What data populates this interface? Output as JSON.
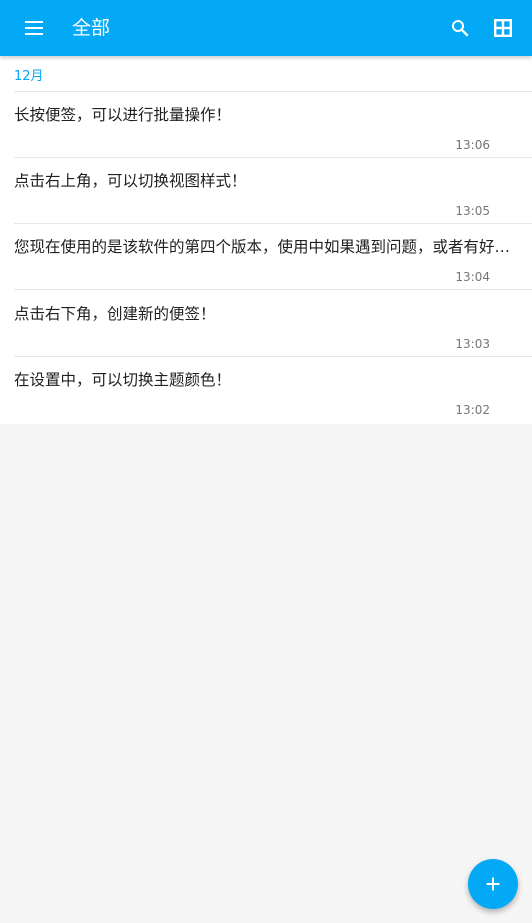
{
  "app_bar": {
    "title": "全部",
    "background_color": "#03a9f4",
    "menu_icon": "menu-icon",
    "search_icon": "search-icon",
    "view_toggle_icon": "grid-view-icon"
  },
  "list": {
    "month_header": "12月",
    "accent_color": "#03a9f4",
    "notes": [
      {
        "text": "长按便签，可以进行批量操作！",
        "time": "13:06"
      },
      {
        "text": "点击右上角，可以切换视图样式！",
        "time": "13:05"
      },
      {
        "text": "您现在使用的是该软件的第四个版本，使用中如果遇到问题，或者有好的建议，欢迎反馈",
        "time": "13:04"
      },
      {
        "text": "点击右下角，创建新的便签！",
        "time": "13:03"
      },
      {
        "text": "在设置中，可以切换主题颜色！",
        "time": "13:02"
      }
    ]
  },
  "fab": {
    "icon": "plus-icon",
    "color": "#03a9f4"
  }
}
